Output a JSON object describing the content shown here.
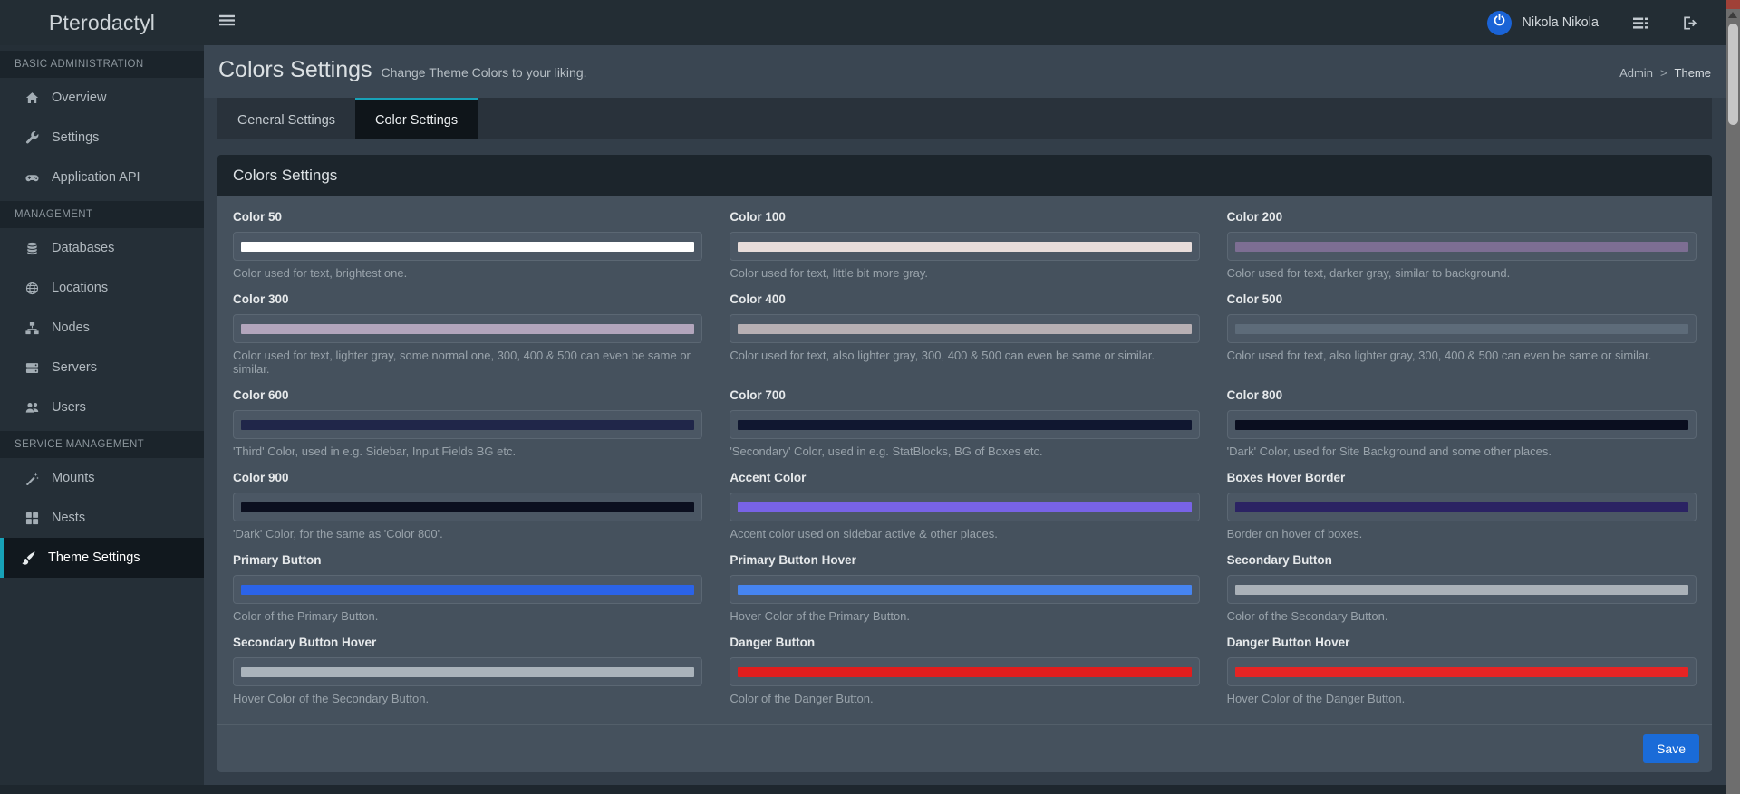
{
  "navbar": {
    "brand": "Pterodactyl",
    "user_name": "Nikola Nikola"
  },
  "breadcrumb": {
    "separator": ">",
    "items": [
      {
        "label": "Admin"
      },
      {
        "label": "Theme"
      }
    ]
  },
  "page_header": {
    "title": "Colors Settings",
    "subtitle": "Change Theme Colors to your liking."
  },
  "tabs": [
    {
      "label": "General Settings",
      "active": false
    },
    {
      "label": "Color Settings",
      "active": true
    }
  ],
  "panel": {
    "title": "Colors Settings",
    "save_label": "Save"
  },
  "sidebar": {
    "sections": [
      {
        "header": "BASIC ADMINISTRATION",
        "items": [
          {
            "label": "Overview",
            "icon": "home",
            "active": false
          },
          {
            "label": "Settings",
            "icon": "wrench",
            "active": false
          },
          {
            "label": "Application API",
            "icon": "gamepad",
            "active": false
          }
        ]
      },
      {
        "header": "MANAGEMENT",
        "items": [
          {
            "label": "Databases",
            "icon": "database",
            "active": false
          },
          {
            "label": "Locations",
            "icon": "globe",
            "active": false
          },
          {
            "label": "Nodes",
            "icon": "sitemap",
            "active": false
          },
          {
            "label": "Servers",
            "icon": "server",
            "active": false
          },
          {
            "label": "Users",
            "icon": "users",
            "active": false
          }
        ]
      },
      {
        "header": "SERVICE MANAGEMENT",
        "items": [
          {
            "label": "Mounts",
            "icon": "magic-wand",
            "active": false
          },
          {
            "label": "Nests",
            "icon": "grid",
            "active": false
          },
          {
            "label": "Theme Settings",
            "icon": "paint-brush",
            "active": true
          }
        ]
      }
    ]
  },
  "fields": [
    {
      "label": "Color 50",
      "value": "#ffffff",
      "description": "Color used for text, brightest one."
    },
    {
      "label": "Color 100",
      "value": "#e7dcda",
      "description": "Color used for text, little bit more gray."
    },
    {
      "label": "Color 200",
      "value": "#7d6e93",
      "description": "Color used for text, darker gray, similar to background."
    },
    {
      "label": "Color 300",
      "value": "#b2a5bc",
      "description": "Color used for text, lighter gray, some normal one, 300, 400 & 500 can even be same or similar."
    },
    {
      "label": "Color 400",
      "value": "#b7afb3",
      "description": "Color used for text, also lighter gray, 300, 400 & 500 can even be same or similar."
    },
    {
      "label": "Color 500",
      "value": "#5d6b79",
      "description": "Color used for text, also lighter gray, 300, 400 & 500 can even be same or similar."
    },
    {
      "label": "Color 600",
      "value": "#202649",
      "description": "'Third' Color, used in e.g. Sidebar, Input Fields BG etc."
    },
    {
      "label": "Color 700",
      "value": "#101730",
      "description": "'Secondary' Color, used in e.g. StatBlocks, BG of Boxes etc."
    },
    {
      "label": "Color 800",
      "value": "#0a0e1f",
      "description": "'Dark' Color, used for Site Background and some other places."
    },
    {
      "label": "Color 900",
      "value": "#0b0f1f",
      "description": "'Dark' Color, for the same as 'Color 800'."
    },
    {
      "label": "Accent Color",
      "value": "#7863e6",
      "description": "Accent color used on sidebar active & other places."
    },
    {
      "label": "Boxes Hover Border",
      "value": "#2b2363",
      "description": "Border on hover of boxes."
    },
    {
      "label": "Primary Button",
      "value": "#2b63e8",
      "description": "Color of the Primary Button."
    },
    {
      "label": "Primary Button Hover",
      "value": "#4684f0",
      "description": "Hover Color of the Primary Button."
    },
    {
      "label": "Secondary Button",
      "value": "#aab1b8",
      "description": "Color of the Secondary Button."
    },
    {
      "label": "Secondary Button Hover",
      "value": "#aab3bb",
      "description": "Hover Color of the Secondary Button."
    },
    {
      "label": "Danger Button",
      "value": "#e11d1d",
      "description": "Color of the Danger Button."
    },
    {
      "label": "Danger Button Hover",
      "value": "#e62424",
      "description": "Hover Color of the Danger Button."
    }
  ],
  "theme": {
    "accent_teal": "#17a2b8",
    "save_blue": "#1a6bd8",
    "avatar_blue": "#1a63d6"
  }
}
